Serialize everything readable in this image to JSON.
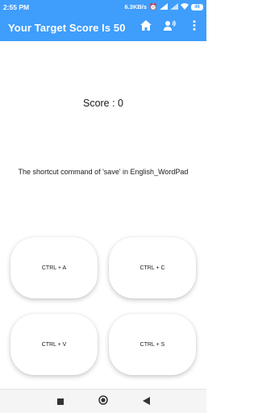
{
  "status": {
    "time": "2:55 PM",
    "speed": "6.3KB/s",
    "battery": "46"
  },
  "header": {
    "title": "Your Target Score Is 50",
    "icons": [
      "home-icon",
      "voice-icon",
      "more-vert-icon"
    ]
  },
  "colors": {
    "accent": "#3f9dfc"
  },
  "quiz": {
    "score_text": "Score : 0",
    "question": "The shortcut command of 'save' in English_WordPad",
    "options": [
      "CTRL + A",
      "CTRL + C",
      "CTRL + V",
      "CTRL + S"
    ]
  },
  "navbar": {
    "icons": [
      "recents-icon",
      "home-circle-icon",
      "back-icon"
    ]
  }
}
